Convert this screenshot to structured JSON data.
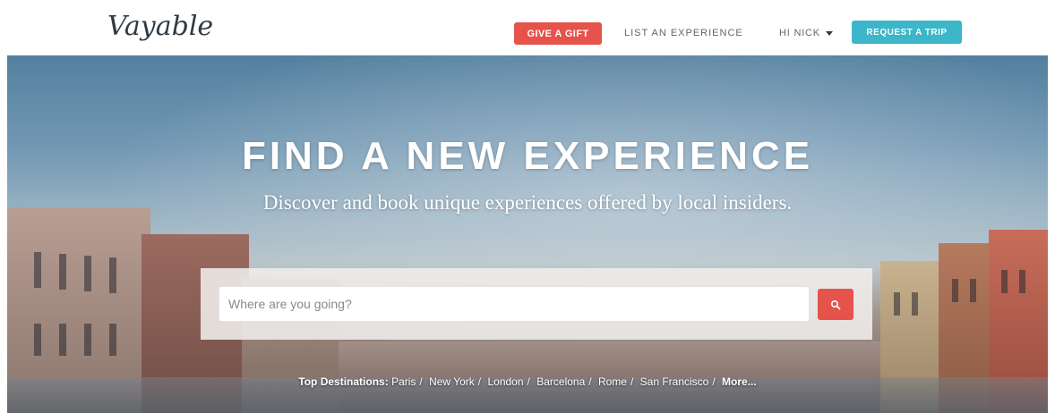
{
  "header": {
    "logo": "Vayable",
    "give_gift": "GIVE A GIFT",
    "list_experience": "LIST AN EXPERIENCE",
    "user_menu": "HI NICK",
    "request_trip": "REQUEST A TRIP"
  },
  "hero": {
    "title": "FIND A NEW EXPERIENCE",
    "subtitle": "Discover and book unique experiences offered by local insiders.",
    "search": {
      "placeholder": "Where are you going?",
      "button_icon": "search-icon"
    },
    "destinations": {
      "label": "Top Destinations:",
      "items": [
        "Paris",
        "New York",
        "London",
        "Barcelona",
        "Rome",
        "San Francisco"
      ],
      "more": "More..."
    }
  },
  "colors": {
    "accent_red": "#e5534b",
    "accent_teal": "#3cb6c9",
    "nav_text": "#5b6770"
  }
}
